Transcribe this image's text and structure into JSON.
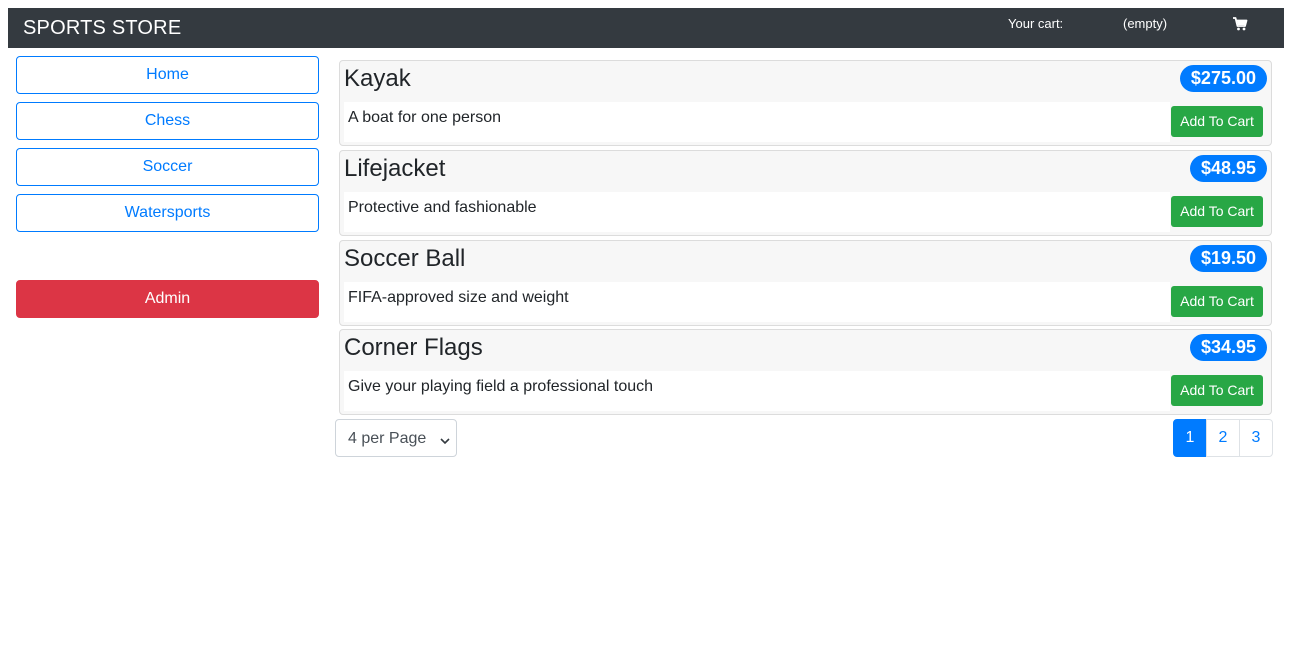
{
  "header": {
    "brand": "SPORTS STORE",
    "cart_label": "Your cart:",
    "cart_value": "(empty)",
    "cart_icon": "shopping-cart-icon"
  },
  "sidebar": {
    "categories": [
      "Home",
      "Chess",
      "Soccer",
      "Watersports"
    ],
    "admin_label": "Admin"
  },
  "products": [
    {
      "name": "Kayak",
      "price": "$275.00",
      "description": "A boat for one person",
      "button": "Add To Cart"
    },
    {
      "name": "Lifejacket",
      "price": "$48.95",
      "description": "Protective and fashionable",
      "button": "Add To Cart"
    },
    {
      "name": "Soccer Ball",
      "price": "$19.50",
      "description": "FIFA-approved size and weight",
      "button": "Add To Cart"
    },
    {
      "name": "Corner Flags",
      "price": "$34.95",
      "description": "Give your playing field a professional touch",
      "button": "Add To Cart"
    }
  ],
  "pagination": {
    "per_page_label": "4 per Page",
    "pages": [
      "1",
      "2",
      "3"
    ],
    "current_page": "1"
  },
  "colors": {
    "navbar": "#343a40",
    "primary": "#007bff",
    "danger": "#dc3545",
    "success": "#28a745"
  }
}
